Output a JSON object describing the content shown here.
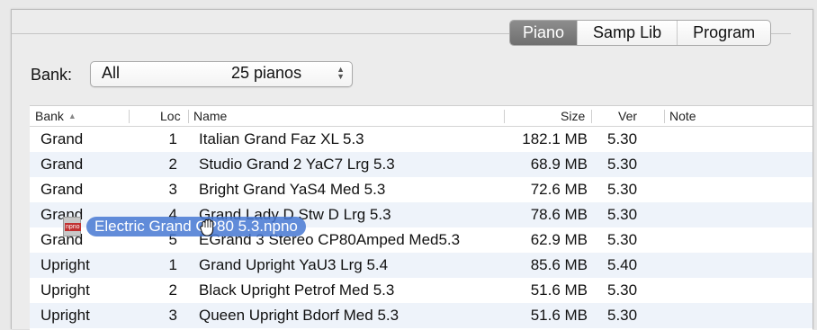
{
  "tabs": [
    {
      "label": "Piano",
      "active": true
    },
    {
      "label": "Samp Lib",
      "active": false
    },
    {
      "label": "Program",
      "active": false
    }
  ],
  "bank": {
    "label": "Bank:",
    "selected": "All",
    "count": "25 pianos"
  },
  "table": {
    "headers": {
      "bank": "Bank",
      "loc": "Loc",
      "name": "Name",
      "size": "Size",
      "ver": "Ver",
      "note": "Note"
    },
    "rows": [
      {
        "bank": "Grand",
        "loc": "1",
        "name": "Italian Grand Faz XL 5.3",
        "size": "182.1 MB",
        "ver": "5.30"
      },
      {
        "bank": "Grand",
        "loc": "2",
        "name": "Studio Grand 2 YaC7  Lrg 5.3",
        "size": "68.9 MB",
        "ver": "5.30"
      },
      {
        "bank": "Grand",
        "loc": "3",
        "name": "Bright Grand YaS4  Med 5.3",
        "size": "72.6 MB",
        "ver": "5.30"
      },
      {
        "bank": "Grand",
        "loc": "4",
        "name": "Grand Lady D  Stw D  Lrg 5.3",
        "size": "78.6 MB",
        "ver": "5.30"
      },
      {
        "bank": "Grand",
        "loc": "5",
        "name": "EGrand 3 Stereo CP80Amped Med5.3",
        "size": "62.9 MB",
        "ver": "5.30"
      },
      {
        "bank": "Upright",
        "loc": "1",
        "name": "Grand Upright YaU3 Lrg 5.4",
        "size": "85.6 MB",
        "ver": "5.40"
      },
      {
        "bank": "Upright",
        "loc": "2",
        "name": "Black Upright Petrof Med 5.3",
        "size": "51.6 MB",
        "ver": "5.30"
      },
      {
        "bank": "Upright",
        "loc": "3",
        "name": "Queen Upright Bdorf Med 5.3",
        "size": "51.6 MB",
        "ver": "5.30"
      }
    ]
  },
  "drag": {
    "file_badge": "npno",
    "filename": "Electric Grand CP80  5.3.npno",
    "cursor_icon": "hand-grab-icon",
    "file_icon": "file-icon"
  }
}
